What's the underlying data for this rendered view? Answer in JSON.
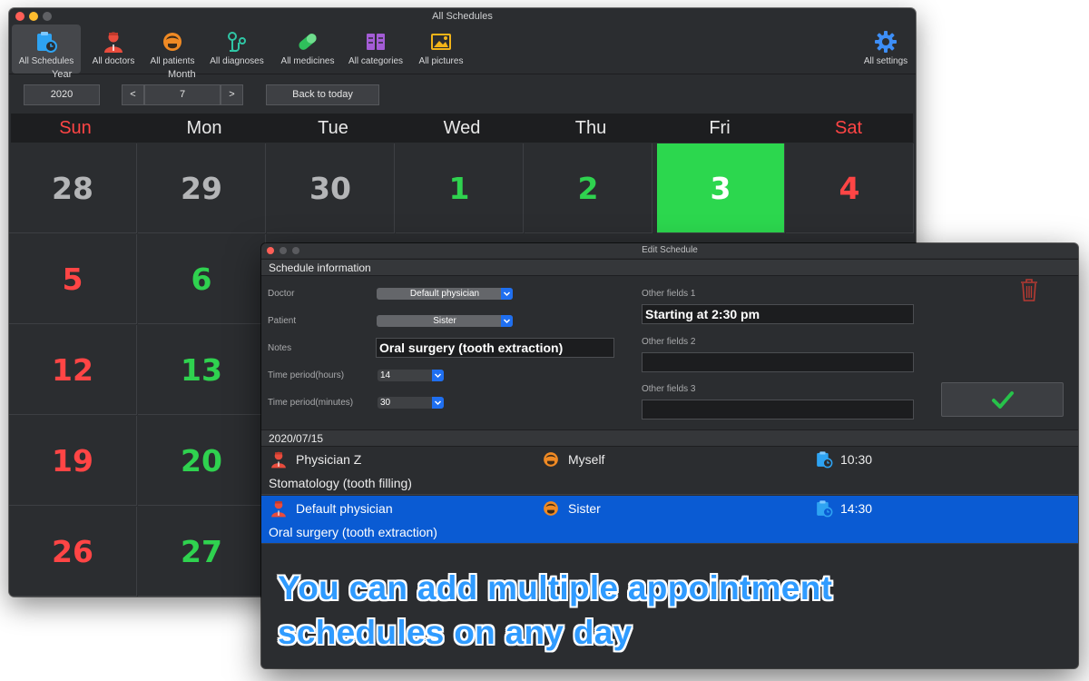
{
  "main_window": {
    "title": "All Schedules",
    "toolbar": [
      {
        "label": "All Schedules",
        "icon": "schedule-icon",
        "active": true
      },
      {
        "label": "All doctors",
        "icon": "doctor-icon"
      },
      {
        "label": "All patients",
        "icon": "patient-icon"
      },
      {
        "label": "All diagnoses",
        "icon": "stethoscope-icon"
      },
      {
        "label": "All medicines",
        "icon": "pill-icon"
      },
      {
        "label": "All categories",
        "icon": "categories-icon"
      },
      {
        "label": "All pictures",
        "icon": "pictures-icon"
      },
      {
        "label": "All settings",
        "icon": "gear-icon"
      }
    ],
    "nav": {
      "year_label": "Year",
      "year_value": "2020",
      "month_label": "Month",
      "month_value": "7",
      "prev": "<",
      "next": ">",
      "back_to_today": "Back to today"
    },
    "weekdays": [
      "Sun",
      "Mon",
      "Tue",
      "Wed",
      "Thu",
      "Fri",
      "Sat"
    ],
    "calendar_rows": [
      [
        "28",
        "29",
        "30",
        "1",
        "2",
        "3",
        "4"
      ],
      [
        "5",
        "6",
        "",
        "",
        "",
        "",
        ""
      ],
      [
        "12",
        "13",
        "",
        "",
        "",
        "",
        ""
      ],
      [
        "19",
        "20",
        "",
        "",
        "",
        "",
        ""
      ],
      [
        "26",
        "27",
        "",
        "",
        "",
        "",
        ""
      ]
    ],
    "today": "3",
    "colors": {
      "weekend": "#ff4545",
      "weekday": "#2fd24f",
      "other_month": "#b4b5b7",
      "today_bg": "#2cd74e"
    }
  },
  "dialog": {
    "title": "Edit Schedule",
    "section_title": "Schedule information",
    "doctor_label": "Doctor",
    "doctor_value": "Default physician",
    "patient_label": "Patient",
    "patient_value": "Sister",
    "notes_label": "Notes",
    "notes_value": "Oral surgery (tooth extraction)",
    "hours_label": "Time period(hours)",
    "hours_value": "14",
    "minutes_label": "Time period(minutes)",
    "minutes_value": "30",
    "other1_label": "Other fields 1",
    "other1_value": "Starting at 2:30 pm",
    "other2_label": "Other fields 2",
    "other2_value": "",
    "other3_label": "Other fields 3",
    "other3_value": "",
    "date_header": "2020/07/15",
    "appointments": [
      {
        "doctor": "Physician Z",
        "patient": "Myself",
        "time": "10:30",
        "notes": "Stomatology (tooth filling)",
        "selected": false
      },
      {
        "doctor": "Default physician",
        "patient": "Sister",
        "time": "14:30",
        "notes": "Oral surgery (tooth extraction)",
        "selected": true
      }
    ],
    "caption_line1": "You can add multiple appointment",
    "caption_line2": "schedules on any day"
  }
}
